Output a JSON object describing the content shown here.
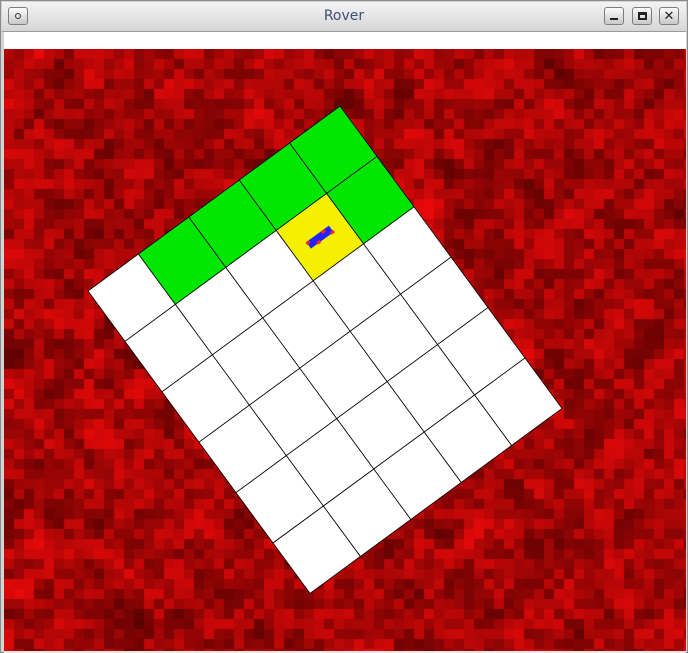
{
  "window": {
    "title": "Rover",
    "buttons": {
      "menu_icon": "window-menu-icon",
      "minimize_icon": "minimize-icon",
      "maximize_icon": "maximize-icon",
      "close_icon": "close-icon"
    }
  },
  "colors": {
    "terrain_dark": "#5a0000",
    "terrain_mid": "#a30000",
    "terrain_bright": "#e80000",
    "grid_cell": "#ffffff",
    "grid_line": "#000000",
    "visited_cell": "#00e600",
    "current_cell": "#f5f000",
    "rover_body": "#2222ff",
    "rover_accent": "#ff2222"
  },
  "grid": {
    "rows": 6,
    "cols": 5,
    "cells": [
      [
        "white",
        "green",
        "green",
        "green",
        "green"
      ],
      [
        "white",
        "white",
        "white",
        "yellow",
        "green"
      ],
      [
        "white",
        "white",
        "white",
        "white",
        "white"
      ],
      [
        "white",
        "white",
        "white",
        "white",
        "white"
      ],
      [
        "white",
        "white",
        "white",
        "white",
        "white"
      ],
      [
        "white",
        "white",
        "white",
        "white",
        "white"
      ]
    ],
    "rover": {
      "row": 1,
      "col": 3
    }
  }
}
